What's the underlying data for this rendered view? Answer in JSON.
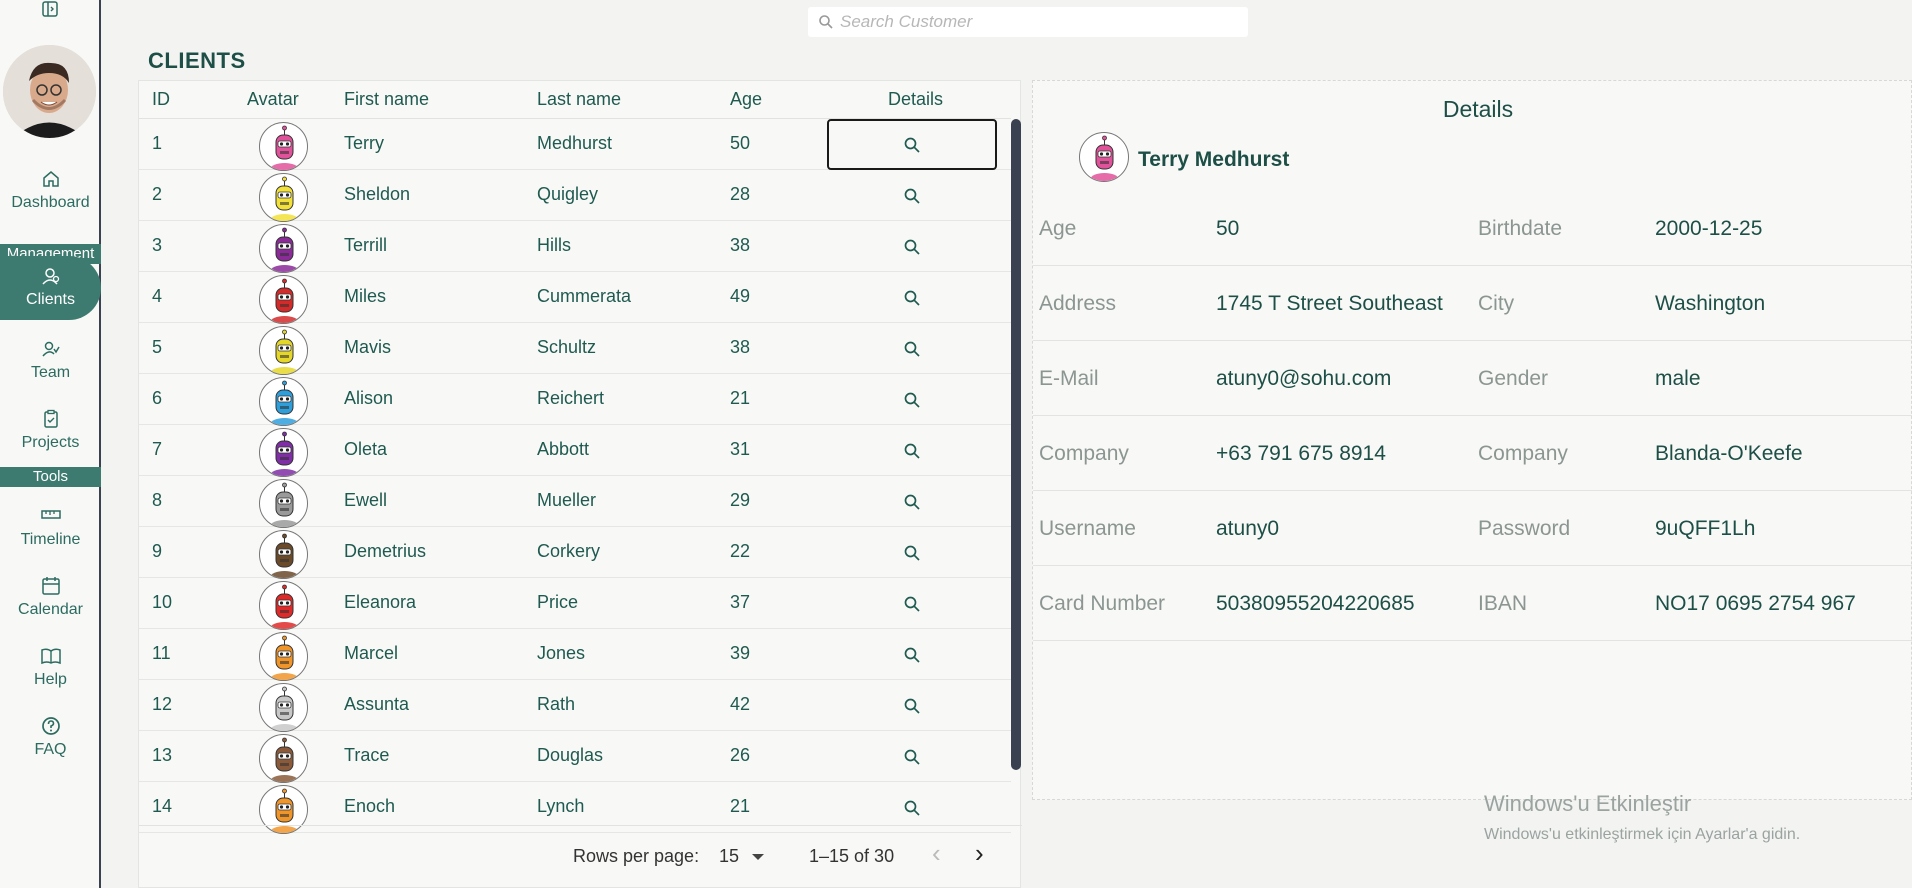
{
  "sidebar": {
    "nav": {
      "dashboard": "Dashboard",
      "section_management": "Management",
      "clients": "Clients",
      "team": "Team",
      "projects": "Projects",
      "section_tools": "Tools",
      "timeline": "Timeline",
      "calendar": "Calendar",
      "help": "Help",
      "faq": "FAQ"
    }
  },
  "search": {
    "placeholder": "Search Customer"
  },
  "page": {
    "title": "CLIENTS"
  },
  "table": {
    "headers": {
      "id": "ID",
      "avatar": "Avatar",
      "first": "First name",
      "last": "Last name",
      "age": "Age",
      "details": "Details"
    },
    "rows": [
      {
        "id": "1",
        "first": "Terry",
        "last": "Medhurst",
        "age": "50",
        "color": "#e0529a"
      },
      {
        "id": "2",
        "first": "Sheldon",
        "last": "Quigley",
        "age": "28",
        "color": "#f2e13a"
      },
      {
        "id": "3",
        "first": "Terrill",
        "last": "Hills",
        "age": "38",
        "color": "#8a2b98"
      },
      {
        "id": "4",
        "first": "Miles",
        "last": "Cummerata",
        "age": "49",
        "color": "#d42a2a"
      },
      {
        "id": "5",
        "first": "Mavis",
        "last": "Schultz",
        "age": "38",
        "color": "#e5d72a"
      },
      {
        "id": "6",
        "first": "Alison",
        "last": "Reichert",
        "age": "21",
        "color": "#2f9fdc"
      },
      {
        "id": "7",
        "first": "Oleta",
        "last": "Abbott",
        "age": "31",
        "color": "#7f2ea5"
      },
      {
        "id": "8",
        "first": "Ewell",
        "last": "Mueller",
        "age": "29",
        "color": "#9a9a9a"
      },
      {
        "id": "9",
        "first": "Demetrius",
        "last": "Corkery",
        "age": "22",
        "color": "#6b4a2a"
      },
      {
        "id": "10",
        "first": "Eleanora",
        "last": "Price",
        "age": "37",
        "color": "#e02a2a"
      },
      {
        "id": "11",
        "first": "Marcel",
        "last": "Jones",
        "age": "39",
        "color": "#f0952a"
      },
      {
        "id": "12",
        "first": "Assunta",
        "last": "Rath",
        "age": "42",
        "color": "#c8c8c8"
      },
      {
        "id": "13",
        "first": "Trace",
        "last": "Douglas",
        "age": "26",
        "color": "#8a5a3a"
      },
      {
        "id": "14",
        "first": "Enoch",
        "last": "Lynch",
        "age": "21",
        "color": "#f0952a"
      }
    ],
    "footer": {
      "rows_per_page_label": "Rows per page:",
      "rows_per_page_value": "15",
      "range": "1–15 of 30",
      "prev": "‹",
      "next": "›"
    }
  },
  "details": {
    "title": "Details",
    "name": "Terry Medhurst",
    "avatar_color": "#e0529a",
    "fields": [
      {
        "l1": "Age",
        "v1": "50",
        "l2": "Birthdate",
        "v2": "2000-12-25"
      },
      {
        "l1": "Address",
        "v1": "1745 T Street Southeast",
        "l2": "City",
        "v2": "Washington"
      },
      {
        "l1": "E-Mail",
        "v1": "atuny0@sohu.com",
        "l2": "Gender",
        "v2": "male"
      },
      {
        "l1": "Company",
        "v1": "+63 791 675 8914",
        "l2": "Company",
        "v2": "Blanda-O'Keefe"
      },
      {
        "l1": "Username",
        "v1": "atuny0",
        "l2": "Password",
        "v2": "9uQFF1Lh"
      },
      {
        "l1": "Card Number",
        "v1": "50380955204220685",
        "l2": "IBAN",
        "v2": "NO17 0695 2754 967"
      }
    ]
  },
  "watermark": {
    "title": "Windows'u Etkinleştir",
    "subtitle": "Windows'u etkinleştirmek için Ayarlar'a gidin."
  }
}
